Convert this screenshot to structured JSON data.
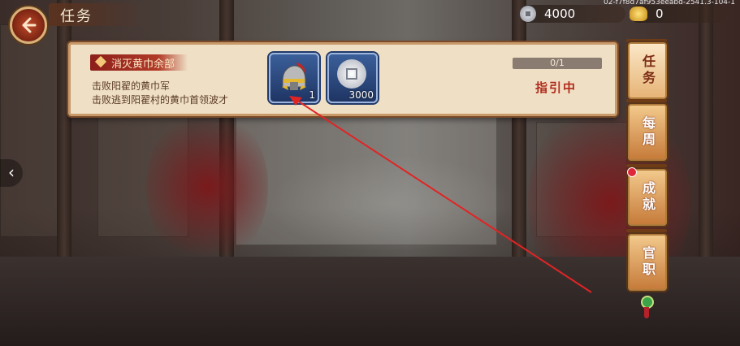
{
  "header": {
    "title": "任务",
    "serial": "02-f7f8d7af953eeabd-2541.3-104-1"
  },
  "currencies": [
    {
      "icon": "silver-coin-icon",
      "value": "4000"
    },
    {
      "icon": "gold-ingot-icon",
      "value": "0"
    }
  ],
  "quest": {
    "name": "消灭黄巾余部",
    "lines": [
      "击败阳翟的黄巾军",
      "击败逃到阳翟村的黄巾首领波才"
    ],
    "rewards": [
      {
        "icon": "helmet-icon",
        "count": "1"
      },
      {
        "icon": "silver-coin-icon",
        "count": "3000"
      }
    ],
    "progress_text": "0/1",
    "progress_fraction": 0,
    "action": "指引中"
  },
  "tabs": [
    {
      "label": "任务",
      "active": true
    },
    {
      "label": "每周",
      "active": false
    },
    {
      "label": "成就",
      "active": false,
      "badge": true
    },
    {
      "label": "官职",
      "active": false
    }
  ],
  "colors": {
    "accent": "#b02a1b",
    "card_bg": "#efdfc4",
    "annotation_arrow": "#e02424"
  }
}
